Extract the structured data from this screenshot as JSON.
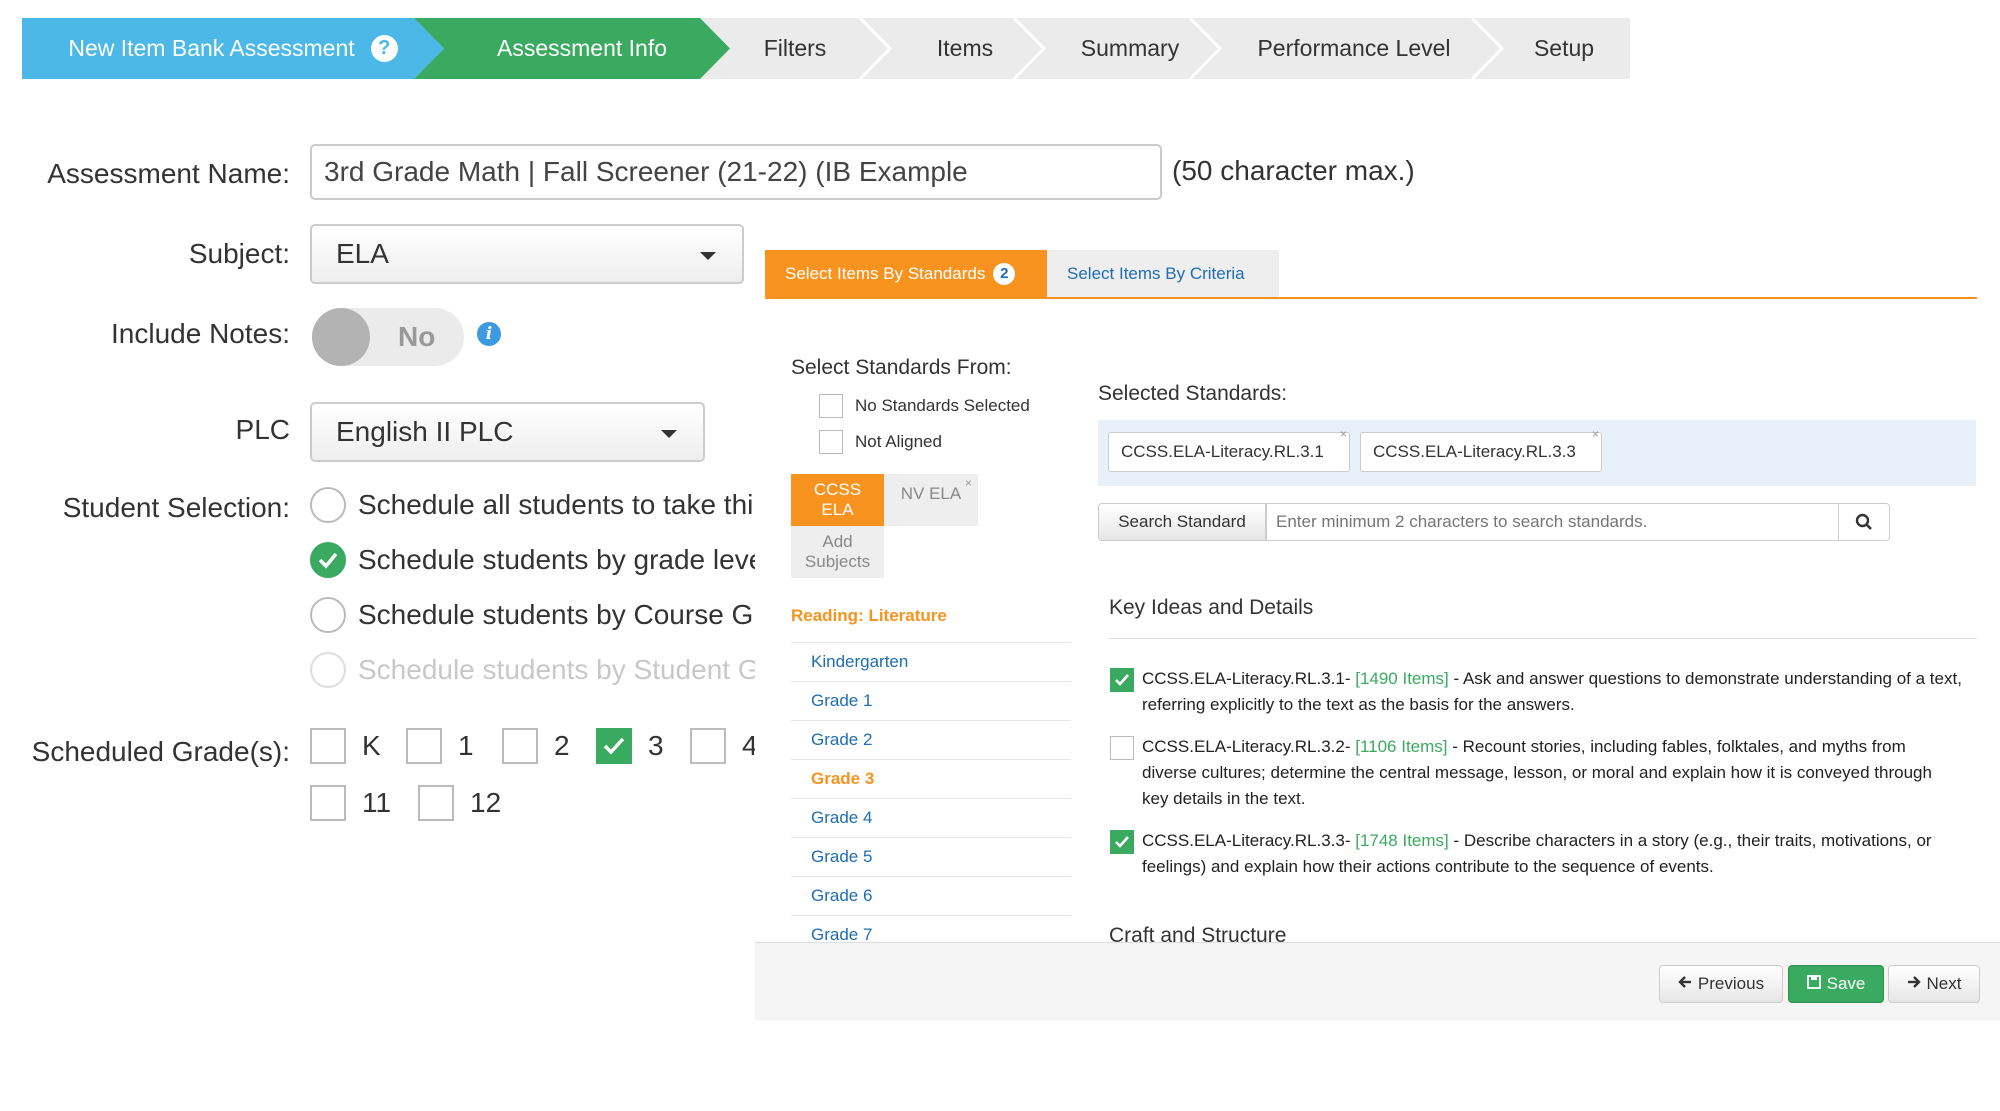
{
  "wizard": {
    "steps": [
      {
        "label": "New Item Bank Assessment",
        "state": "first"
      },
      {
        "label": "Assessment Info",
        "state": "active"
      },
      {
        "label": "Filters",
        "state": "pending"
      },
      {
        "label": "Items",
        "state": "pending"
      },
      {
        "label": "Summary",
        "state": "pending"
      },
      {
        "label": "Performance Level",
        "state": "pending"
      },
      {
        "label": "Setup",
        "state": "pending"
      }
    ],
    "help_glyph": "?"
  },
  "form": {
    "assessment_name_label": "Assessment Name:",
    "assessment_name_value": "3rd Grade Math | Fall Screener (21-22) (IB Example",
    "assessment_name_note": "(50 character max.)",
    "subject_label": "Subject:",
    "subject_value": "ELA",
    "include_notes_label": "Include Notes:",
    "include_notes_value": "No",
    "plc_label": "PLC",
    "plc_value": "English II PLC",
    "student_selection_label": "Student Selection:",
    "student_options": [
      "Schedule all students to take thi",
      "Schedule students by grade leve",
      "Schedule students by Course Gr",
      "Schedule students by Student G"
    ],
    "scheduled_grades_label": "Scheduled Grade(s):",
    "grades": [
      {
        "label": "K",
        "checked": false
      },
      {
        "label": "1",
        "checked": false
      },
      {
        "label": "2",
        "checked": false
      },
      {
        "label": "3",
        "checked": true
      },
      {
        "label": "4",
        "checked": false
      },
      {
        "label": "11",
        "checked": false
      },
      {
        "label": "12",
        "checked": false
      }
    ]
  },
  "panel": {
    "tab_standards": "Select Items By Standards",
    "tab_standards_badge": "2",
    "tab_criteria": "Select Items By Criteria",
    "select_from_label": "Select Standards From:",
    "no_standards_label": "No Standards Selected",
    "not_aligned_label": "Not Aligned",
    "subject_active": "CCSS ELA",
    "subject_other": "NV ELA",
    "add_subjects": "Add Subjects",
    "category": "Reading: Literature",
    "grade_links": [
      "Kindergarten",
      "Grade 1",
      "Grade 2",
      "Grade 3",
      "Grade 4",
      "Grade 5",
      "Grade 6",
      "Grade 7"
    ],
    "active_grade": "Grade 3",
    "selected_title": "Selected Standards:",
    "selected_chips": [
      "CCSS.ELA-Literacy.RL.3.1",
      "CCSS.ELA-Literacy.RL.3.3"
    ],
    "search_button": "Search Standard",
    "search_placeholder": "Enter minimum 2 characters to search standards.",
    "section_key_ideas": "Key Ideas and Details",
    "section_craft": "Craft and Structure",
    "standards": [
      {
        "code": "CCSS.ELA-Literacy.RL.3.1-",
        "items": "[1490 Items]",
        "text": " - Ask and answer questions to demonstrate understanding of a text, referring explicitly to the text as the basis for the answers.",
        "checked": true
      },
      {
        "code": "CCSS.ELA-Literacy.RL.3.2-",
        "items": "[1106 Items]",
        "text": " - Recount stories, including fables, folktales, and myths from diverse cultures; determine the central message, lesson, or moral and explain how it is conveyed through key details in the text.",
        "checked": false
      },
      {
        "code": "CCSS.ELA-Literacy.RL.3.3-",
        "items": "[1748 Items]",
        "text": " - Describe characters in a story (e.g., their traits, motivations, or feelings) and explain how their actions contribute to the sequence of events.",
        "checked": true
      }
    ],
    "footer": {
      "previous": "Previous",
      "save": "Save",
      "next": "Next"
    }
  },
  "colors": {
    "accent_blue": "#4cb8e8",
    "active_green": "#3aaa60",
    "orange": "#f7931e",
    "link_blue": "#1f6db2"
  }
}
